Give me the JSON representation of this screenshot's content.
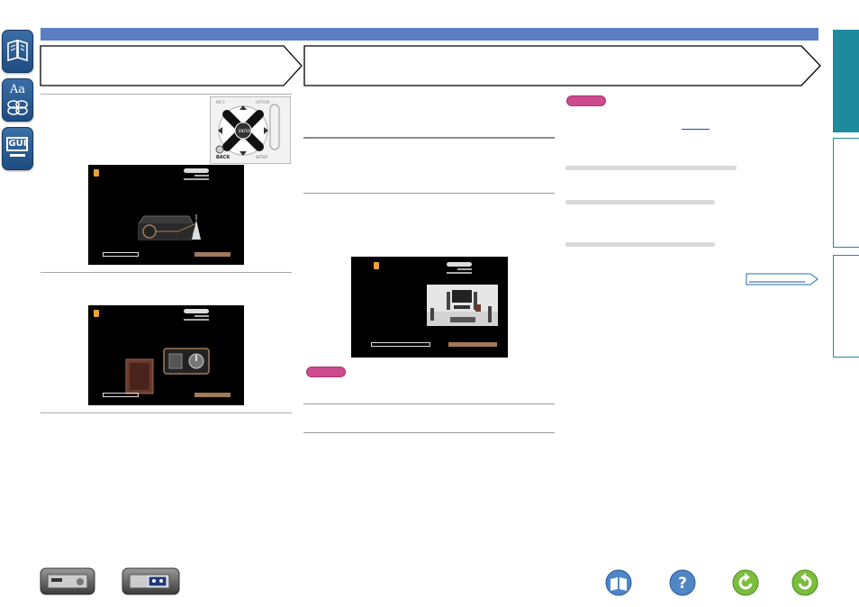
{
  "side_icons": [
    {
      "name": "contents",
      "icon": "book-icon"
    },
    {
      "name": "index",
      "icon": "aa-index-icon",
      "label": "Aa"
    },
    {
      "name": "gui",
      "icon": "gui-icon",
      "label": "GUI"
    }
  ],
  "remote": {
    "enter_label": "ENTER",
    "back_label": "BACK",
    "setup_label": "SETUP",
    "info_label": "INFO",
    "option_label": "OPTION"
  },
  "bottom_nav": [
    {
      "name": "front-panel",
      "icon": "amplifier-front-icon"
    },
    {
      "name": "rear-panel",
      "icon": "amplifier-rear-icon"
    },
    {
      "name": "contents",
      "icon": "book-icon"
    },
    {
      "name": "help",
      "icon": "question-icon",
      "label": "?"
    },
    {
      "name": "back",
      "icon": "back-arrow-icon"
    },
    {
      "name": "forward",
      "icon": "forward-arrow-icon"
    }
  ],
  "colors": {
    "topbar": "#5b7fc3",
    "tab": "#1d8a9e",
    "note": "#cd4b8e",
    "screen_button": "#a07a5a"
  }
}
